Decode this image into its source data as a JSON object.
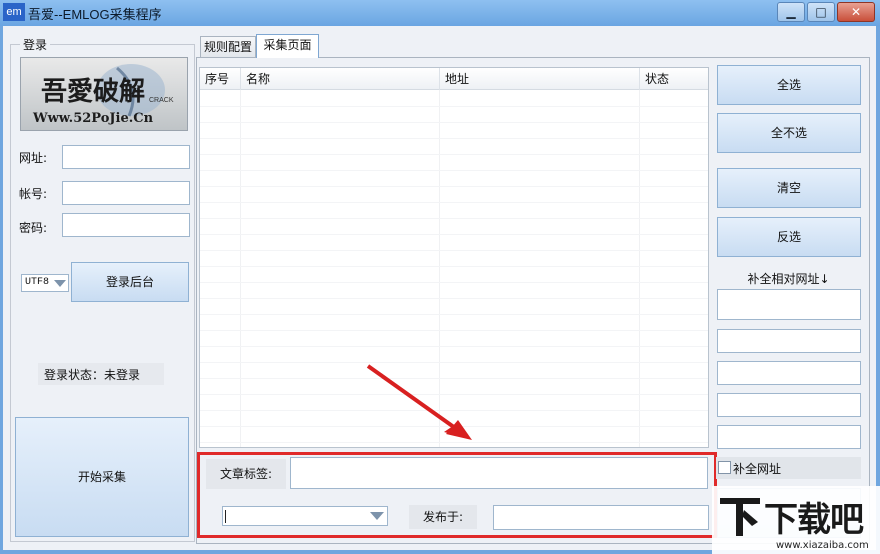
{
  "window": {
    "icon_text": "em",
    "title": "吾爱--EMLOG采集程序",
    "min_glyph": "▁",
    "max_glyph": "□",
    "close_glyph": "✕"
  },
  "login": {
    "group_title": "登录",
    "logo": {
      "line1": "吾愛破解",
      "crack": "CRACK",
      "url": "Www.52PoJie.Cn"
    },
    "url_label": "网址:",
    "account_label": "帐号:",
    "password_label": "密码:",
    "url_value": "",
    "account_value": "",
    "password_value": "",
    "encoding": "UTF8",
    "login_button": "登录后台",
    "status": "登录状态：未登录",
    "start_button": "开始采集"
  },
  "tabs": [
    {
      "label": "规则配置",
      "active": false
    },
    {
      "label": "采集页面",
      "active": true
    }
  ],
  "list": {
    "columns": [
      "序号",
      "名称",
      "地址",
      "状态"
    ],
    "rows": []
  },
  "article": {
    "tag_label": "文章标签:",
    "tag_value": "",
    "category_value": "",
    "publish_label": "发布于:",
    "publish_value": ""
  },
  "actions": {
    "select_all": "全选",
    "select_none": "全不选",
    "clear": "清空",
    "invert": "反选",
    "fill_relative": "补全相对网址↓",
    "fill_fields": [
      "",
      "",
      "",
      "",
      ""
    ],
    "fill_url_checkbox": "补全网址",
    "fill_url_checked": false
  },
  "watermark": {
    "main": "下载吧",
    "sub": "www.xiazaiba.com"
  },
  "colors": {
    "highlight_border": "#e02a2a",
    "arrow": "#d82020",
    "button_top": "#e6f0fb",
    "button_bottom": "#c8dcf2",
    "titlebar": "#6aa5e2"
  }
}
